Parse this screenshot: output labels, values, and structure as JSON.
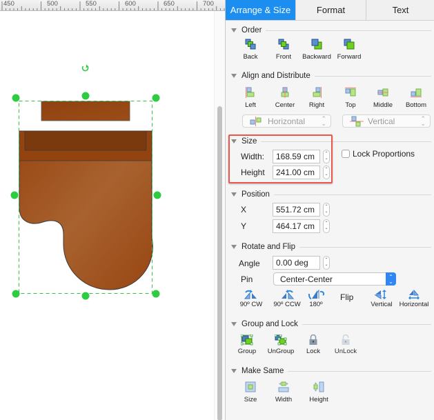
{
  "ruler": {
    "labels": [
      "450",
      "500",
      "550",
      "600",
      "650",
      "700"
    ]
  },
  "canvas": {
    "shape_name": "Grand piano with bench",
    "colors": {
      "fill": "#9a4a14",
      "fill_light": "#a8622f",
      "fill_dark": "#7a3a0d",
      "stroke": "#333333",
      "selection": "#2ecc40"
    }
  },
  "tabs": [
    {
      "label": "Arrange & Size",
      "active": true
    },
    {
      "label": "Format",
      "active": false
    },
    {
      "label": "Text",
      "active": false
    }
  ],
  "order": {
    "title": "Order",
    "buttons": [
      {
        "label": "Back",
        "icon": "send-to-back-icon"
      },
      {
        "label": "Front",
        "icon": "bring-to-front-icon"
      },
      {
        "label": "Backward",
        "icon": "send-backward-icon"
      },
      {
        "label": "Forward",
        "icon": "bring-forward-icon"
      }
    ]
  },
  "align": {
    "title": "Align and Distribute",
    "buttons": [
      {
        "label": "Left",
        "icon": "align-left-icon"
      },
      {
        "label": "Center",
        "icon": "align-center-icon"
      },
      {
        "label": "Right",
        "icon": "align-right-icon"
      },
      {
        "label": "Top",
        "icon": "align-top-icon"
      },
      {
        "label": "Middle",
        "icon": "align-middle-icon"
      },
      {
        "label": "Bottom",
        "icon": "align-bottom-icon"
      }
    ],
    "distribute_horizontal": "Horizontal",
    "distribute_vertical": "Vertical"
  },
  "size": {
    "title": "Size",
    "width_label": "Width:",
    "width_value": "168.59 cm",
    "height_label": "Height",
    "height_value": "241.00 cm",
    "lock_label": "Lock Proportions",
    "lock_checked": false
  },
  "position": {
    "title": "Position",
    "x_label": "X",
    "x_value": "551.72 cm",
    "y_label": "Y",
    "y_value": "464.17 cm"
  },
  "rotate": {
    "title": "Rotate and Flip",
    "angle_label": "Angle",
    "angle_value": "0.00 deg",
    "pin_label": "Pin",
    "pin_value": "Center-Center",
    "buttons": [
      {
        "label": "90º CW",
        "icon": "rotate-cw-icon"
      },
      {
        "label": "90º CCW",
        "icon": "rotate-ccw-icon"
      },
      {
        "label": "180º",
        "icon": "rotate-180-icon"
      }
    ],
    "flip_label": "Flip",
    "flip_buttons": [
      {
        "label": "Vertical",
        "icon": "flip-vertical-icon"
      },
      {
        "label": "Horizontal",
        "icon": "flip-horizontal-icon"
      }
    ]
  },
  "group": {
    "title": "Group and Lock",
    "buttons": [
      {
        "label": "Group",
        "icon": "group-icon"
      },
      {
        "label": "UnGroup",
        "icon": "ungroup-icon"
      },
      {
        "label": "Lock",
        "icon": "lock-icon"
      },
      {
        "label": "UnLock",
        "icon": "unlock-icon"
      }
    ]
  },
  "make_same": {
    "title": "Make Same",
    "buttons": [
      {
        "label": "Size",
        "icon": "same-size-icon"
      },
      {
        "label": "Width",
        "icon": "same-width-icon"
      },
      {
        "label": "Height",
        "icon": "same-height-icon"
      }
    ]
  }
}
